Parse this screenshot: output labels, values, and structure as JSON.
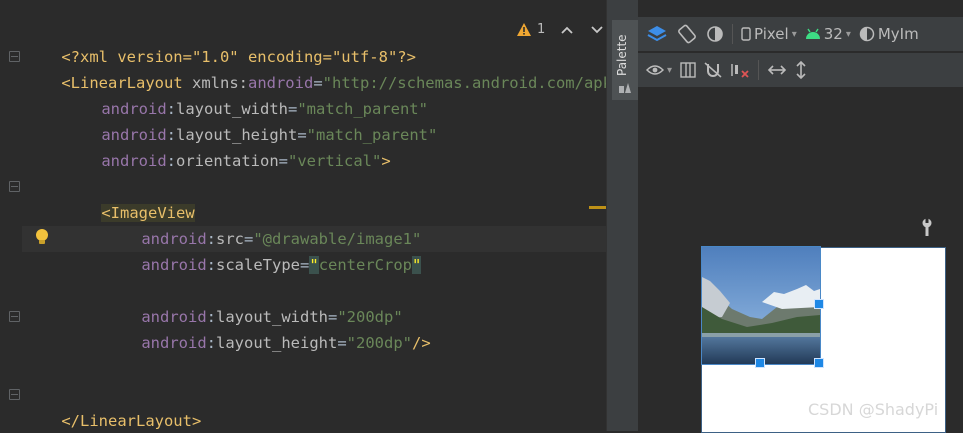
{
  "editor": {
    "lines": {
      "l1": {
        "decl": "<?xml version=\"1.0\" encoding=\"utf-8\"?>"
      },
      "l2": {
        "open": "<",
        "tag": "LinearLayout",
        "ns": " xmlns:",
        "nsattr": "android",
        "eq": "=",
        "val": "\"http://schemas.android.com/apk/res/android\""
      },
      "l3": {
        "ns": "android",
        "colon": ":",
        "attr": "layout_width",
        "eq": "=",
        "val": "\"match_parent\""
      },
      "l4": {
        "ns": "android",
        "colon": ":",
        "attr": "layout_height",
        "eq": "=",
        "val": "\"match_parent\""
      },
      "l5": {
        "ns": "android",
        "colon": ":",
        "attr": "orientation",
        "eq": "=",
        "val": "\"vertical\"",
        "close": ">"
      },
      "l7": {
        "open": "<",
        "tag": "ImageView"
      },
      "l8": {
        "ns": "android",
        "colon": ":",
        "attr": "src",
        "eq": "=",
        "val": "\"@drawable/image1\""
      },
      "l9": {
        "ns": "android",
        "colon": ":",
        "attr": "scaleType",
        "eq": "=",
        "q1": "\"",
        "val": "centerCrop",
        "q2": "\""
      },
      "l11": {
        "ns": "android",
        "colon": ":",
        "attr": "layout_width",
        "eq": "=",
        "val": "\"200dp\""
      },
      "l12": {
        "ns": "android",
        "colon": ":",
        "attr": "layout_height",
        "eq": "=",
        "val": "\"200dp\"",
        "close": "/>"
      },
      "l15": {
        "tag": "</LinearLayout>"
      }
    },
    "warning_count": "1"
  },
  "palette": {
    "label": "Palette"
  },
  "designer": {
    "device": "Pixel",
    "api": "32",
    "theme": "MyIm"
  },
  "watermark": "CSDN @ShadyPi",
  "colors": {
    "accent": "#1e88e5",
    "warning": "#f0a732",
    "android_green": "#3ddc84"
  }
}
